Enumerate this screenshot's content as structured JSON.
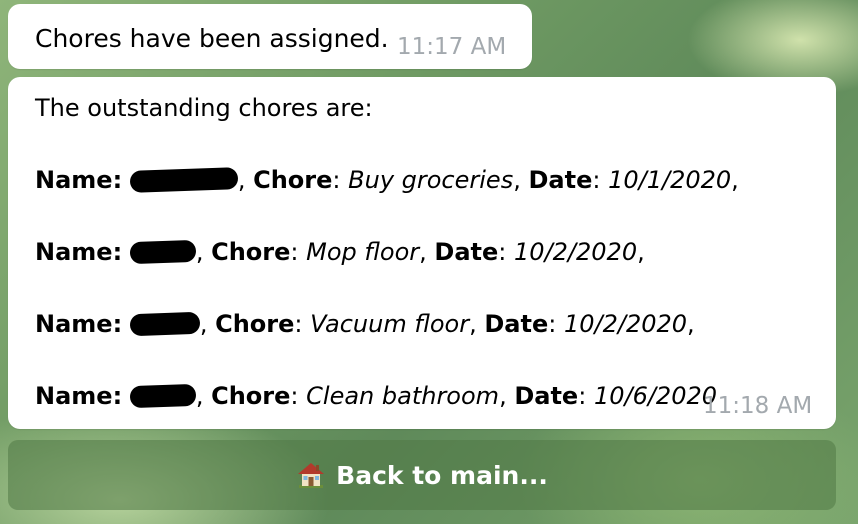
{
  "messages": [
    {
      "text": "Chores have been assigned.",
      "time": "11:17 AM"
    },
    {
      "intro": "The outstanding chores are:",
      "time": "11:18 AM",
      "labels": {
        "name": "Name:",
        "chore": "Chore",
        "date": "Date"
      },
      "separators": {
        "comma": ",",
        "colon": ":"
      },
      "rows": [
        {
          "chore": "Buy groceries",
          "date": "10/1/2020",
          "trailing": ","
        },
        {
          "chore": "Mop floor",
          "date": "10/2/2020",
          "trailing": ","
        },
        {
          "chore": "Vacuum floor",
          "date": "10/2/2020",
          "trailing": ","
        },
        {
          "chore": "Clean bathroom",
          "date": "10/6/2020",
          "trailing": ""
        }
      ]
    }
  ],
  "keyboard": {
    "button_label": "Back to main...",
    "button_icon": "house-icon"
  },
  "colors": {
    "bubble_bg": "#ffffff",
    "timestamp": "#a3a9ae",
    "button_text": "#ffffff"
  }
}
